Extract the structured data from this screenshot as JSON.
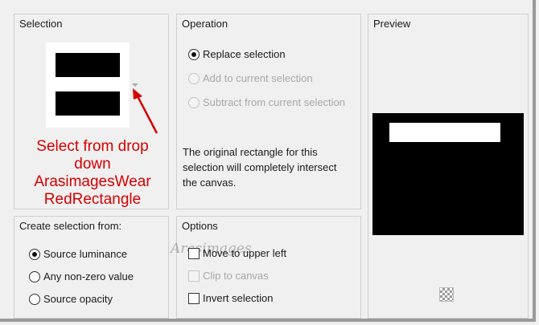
{
  "selection": {
    "title": "Selection",
    "dropdown_icon": "chevron-down-icon"
  },
  "annotation": {
    "lines": [
      "Select from drop",
      "down",
      "ArasimagesWear",
      "RedRectangle"
    ],
    "color": "#d60000"
  },
  "operation": {
    "title": "Operation",
    "options": [
      {
        "label": "Replace selection",
        "checked": true,
        "disabled": false
      },
      {
        "label": "Add to current selection",
        "checked": false,
        "disabled": true
      },
      {
        "label": "Subtract from current selection",
        "checked": false,
        "disabled": true
      }
    ],
    "description": "The original rectangle for this selection will completely intersect the canvas."
  },
  "preview": {
    "title": "Preview",
    "transparency_icon": "checkerboard-icon"
  },
  "create_from": {
    "title": "Create selection from:",
    "options": [
      {
        "label": "Source luminance",
        "checked": true
      },
      {
        "label": "Any non-zero value",
        "checked": false
      },
      {
        "label": "Source opacity",
        "checked": false
      }
    ]
  },
  "options": {
    "title": "Options",
    "items": [
      {
        "label": "Move to upper left",
        "checked": false,
        "disabled": false
      },
      {
        "label": "Clip to canvas",
        "checked": false,
        "disabled": true
      },
      {
        "label": "Invert selection",
        "checked": false,
        "disabled": false
      }
    ]
  },
  "watermark": {
    "text": "Arasimages"
  }
}
